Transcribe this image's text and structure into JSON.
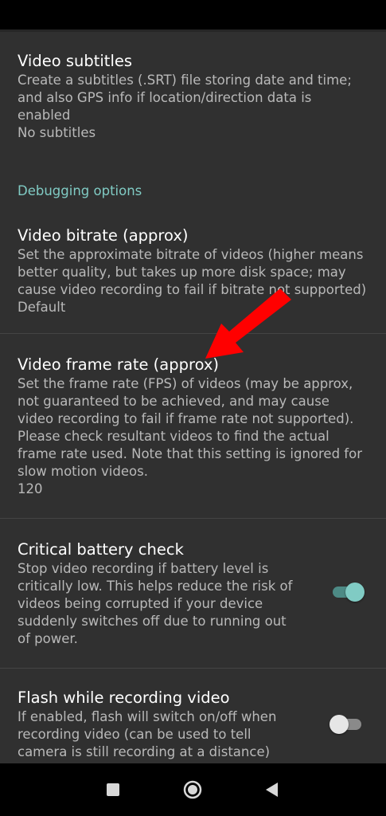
{
  "prefs": {
    "video_subtitles": {
      "title": "Video subtitles",
      "summary": "Create a subtitles (.SRT) file storing date and time; and also GPS info if location/direction data is enabled",
      "value": "No subtitles"
    },
    "debugging_category": "Debugging options",
    "video_bitrate": {
      "title": "Video bitrate (approx)",
      "summary": "Set the approximate bitrate of videos (higher means better quality, but takes up more disk space; may cause video recording to fail if bitrate not supported)",
      "value": "Default"
    },
    "video_frame_rate": {
      "title": "Video frame rate (approx)",
      "summary": "Set the frame rate (FPS) of videos (may be approx, not guaranteed to be achieved, and may cause video recording to fail if frame rate not supported). Please check resultant videos to find the actual frame rate used. Note that this setting is ignored for slow motion videos.",
      "value": "120"
    },
    "critical_battery": {
      "title": "Critical battery check",
      "summary": "Stop video recording if battery level is critically low. This helps reduce the risk of videos being corrupted if your device suddenly switches off due to running out of power.",
      "enabled": true
    },
    "flash_recording": {
      "title": "Flash while recording video",
      "summary": "If enabled, flash will switch on/off when recording video (can be used to tell camera is still recording at a distance)",
      "enabled": false
    }
  },
  "colors": {
    "background": "#303030",
    "accent": "#80cbc4",
    "annotation_arrow": "#ff0000"
  },
  "icons": {
    "annotation": "red-arrow-icon",
    "nav_recents": "square-icon",
    "nav_home": "circle-icon",
    "nav_back": "triangle-back-icon"
  }
}
